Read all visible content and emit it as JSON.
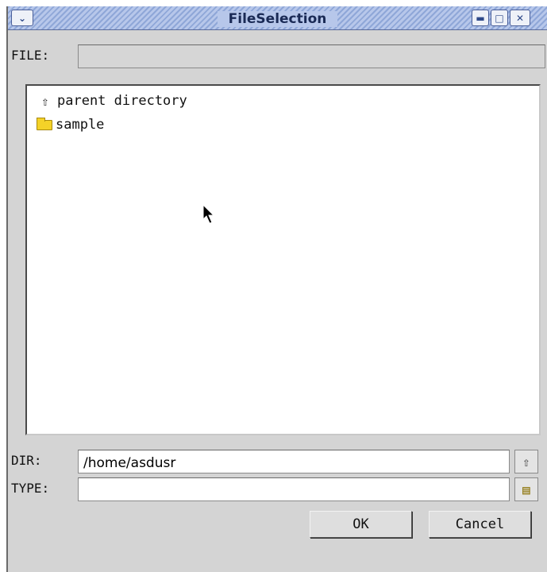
{
  "window": {
    "title": "FileSelection"
  },
  "file": {
    "label": "FILE:",
    "value": ""
  },
  "list": {
    "items": [
      {
        "label": "parent directory",
        "icon": "up-arrow-icon"
      },
      {
        "label": "sample",
        "icon": "folder-icon"
      }
    ]
  },
  "dir": {
    "label": "DIR:",
    "value": "/home/asdusr"
  },
  "type": {
    "label": "TYPE:",
    "value": ""
  },
  "buttons": {
    "ok": "OK",
    "cancel": "Cancel"
  },
  "colors": {
    "titlebar": "#b7c7ea",
    "background": "#d4d4d4",
    "folder": "#f4d228"
  }
}
